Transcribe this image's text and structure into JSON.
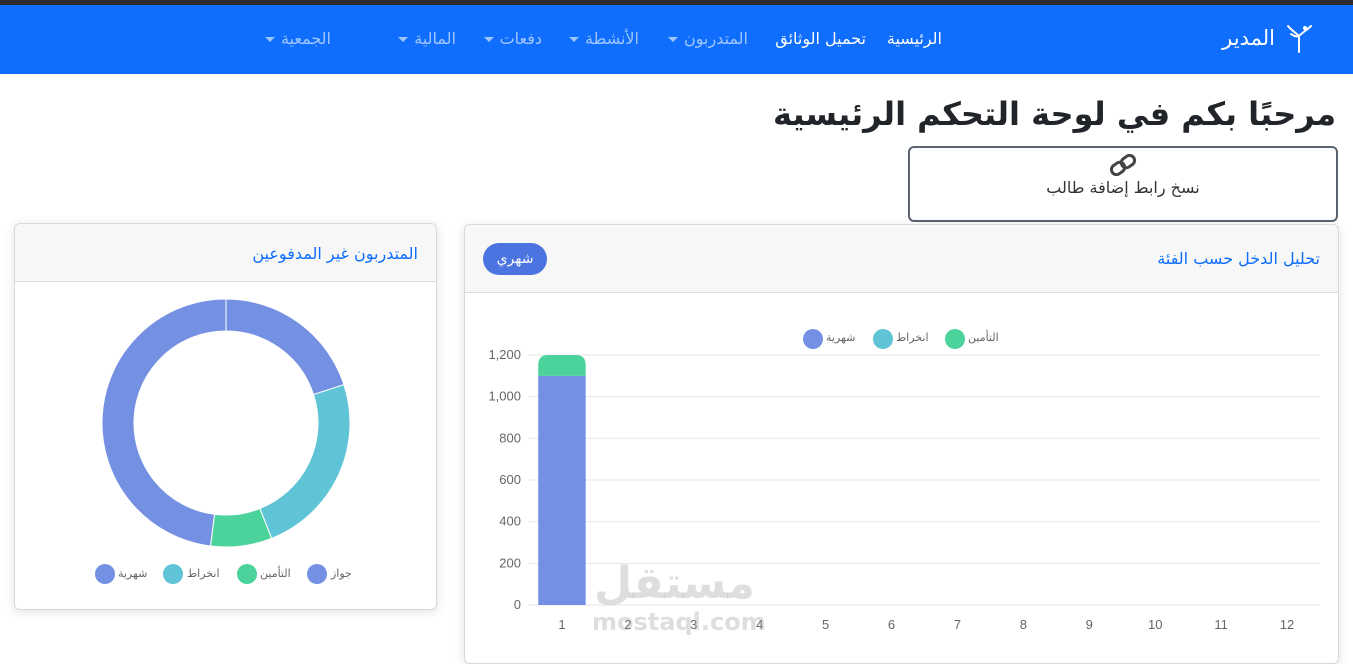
{
  "navbar": {
    "brand": "المدير",
    "items": [
      {
        "label": "الرئيسية",
        "active": true
      },
      {
        "label": "تحميل الوثائق",
        "active": true
      },
      {
        "label": "المتدربون",
        "dropdown": true
      },
      {
        "label": "الأنشطة",
        "dropdown": true
      },
      {
        "label": "دفعات",
        "dropdown": true
      },
      {
        "label": "المالية",
        "dropdown": true
      },
      {
        "label": "الجمعية",
        "dropdown": true
      }
    ],
    "color": "#0f6efd"
  },
  "welcome": "مرحبًا بكم في لوحة التحكم الرئيسية",
  "copy_link": {
    "label": "نسخ رابط إضافة طالب",
    "icon": "link-icon"
  },
  "unpaid_card": {
    "title": "المتدربون غير المدفوعين",
    "legend": [
      "شهرية",
      "انخراط",
      "التأمين",
      "جواز"
    ]
  },
  "income_card": {
    "title": "تحليل الدخل حسب الفئة",
    "filter_button": "شهري",
    "legend": [
      "شهرية",
      "انخراط",
      "التأمين"
    ]
  },
  "colors": {
    "monthly": "#7390e3",
    "registration": "#5fc5d6",
    "insurance": "#4cd39c",
    "passport": "#7390e3"
  },
  "chart_data": [
    {
      "type": "pie",
      "title": "المتدربون غير المدفوعين",
      "labels": [
        "شهرية",
        "انخراط",
        "التأمين",
        "جواز"
      ],
      "values": [
        20,
        24,
        8,
        48
      ],
      "legend_position": "bottom"
    },
    {
      "type": "bar",
      "stacked": true,
      "title": "تحليل الدخل حسب الفئة",
      "categories": [
        "1",
        "2",
        "3",
        "4",
        "5",
        "6",
        "7",
        "8",
        "9",
        "10",
        "11",
        "12"
      ],
      "series": [
        {
          "name": "شهرية",
          "values": [
            1100,
            0,
            0,
            0,
            0,
            0,
            0,
            0,
            0,
            0,
            0,
            0
          ]
        },
        {
          "name": "انخراط",
          "values": [
            0,
            0,
            0,
            0,
            0,
            0,
            0,
            0,
            0,
            0,
            0,
            0
          ]
        },
        {
          "name": "التأمين",
          "values": [
            100,
            0,
            0,
            0,
            0,
            0,
            0,
            0,
            0,
            0,
            0,
            0
          ]
        }
      ],
      "yticks": [
        "0",
        "200",
        "400",
        "600",
        "800",
        "1,000",
        "1,200"
      ],
      "ylim": [
        0,
        1200
      ],
      "legend_position": "top"
    }
  ],
  "watermark": {
    "arabic": "مستقل",
    "latin": "mostaql.com"
  }
}
